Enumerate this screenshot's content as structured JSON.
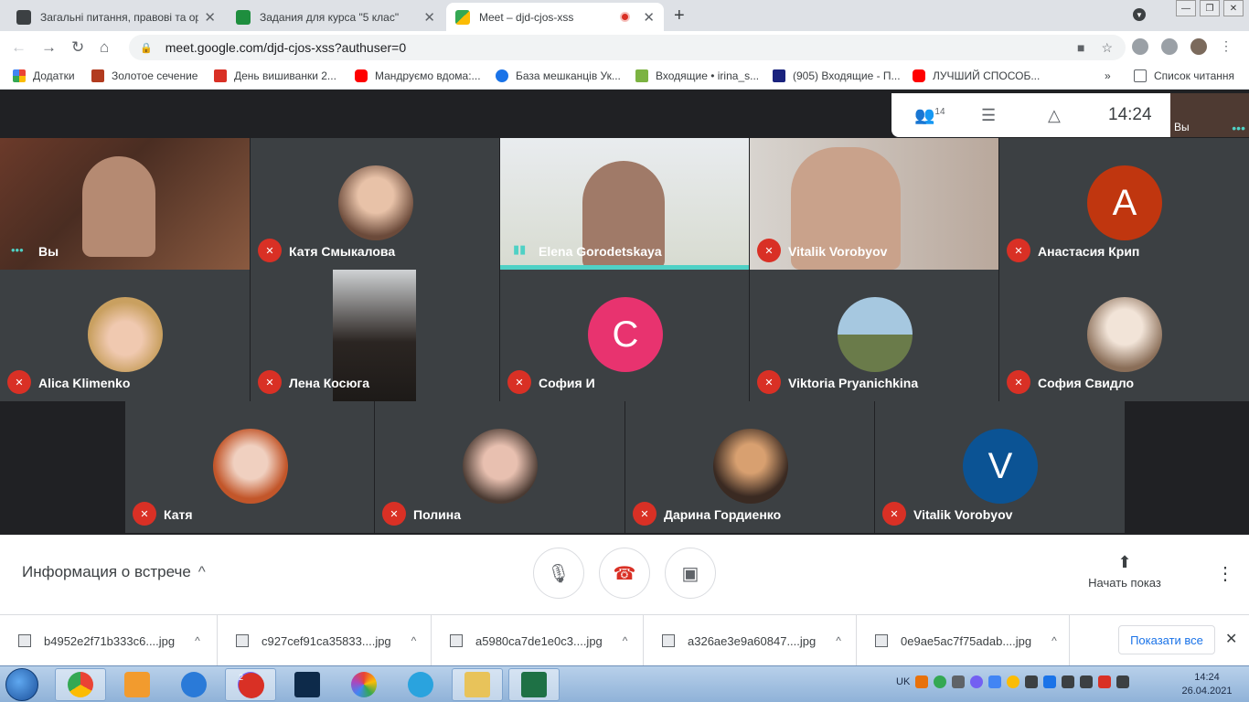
{
  "browser": {
    "tabs": [
      {
        "title": "Загальні питання, правові та ор",
        "active": false
      },
      {
        "title": "Задания для курса \"5 клас\"",
        "active": false
      },
      {
        "title": "Meet – djd-cjos-xss",
        "active": true
      }
    ],
    "url": "meet.google.com/djd-cjos-xss?authuser=0",
    "bookmarks": [
      "Додатки",
      "Золотое сечение",
      "День вишиванки 2...",
      "Мандруємо вдома:...",
      "База мешканців Ук...",
      "Входящие • irina_s...",
      "(905) Входящие - П...",
      "ЛУЧШИЙ СПОСОБ...",
      "Список читання"
    ]
  },
  "meet": {
    "participants_count": "14",
    "clock": "14:24",
    "self_label": "Вы",
    "tiles": [
      {
        "name": "Вы",
        "muted": false,
        "type": "video"
      },
      {
        "name": "Катя Смыкалова",
        "muted": true,
        "type": "photo"
      },
      {
        "name": "Elena Gorodetskaya",
        "muted": false,
        "type": "video",
        "speaking": true
      },
      {
        "name": "Vitalik Vorobyov",
        "muted": true,
        "type": "video"
      },
      {
        "name": "Анастасия Крип",
        "muted": true,
        "type": "letter",
        "letter": "A",
        "color": "#c0360f"
      },
      {
        "name": "Alica Klimenko",
        "muted": true,
        "type": "photo"
      },
      {
        "name": "Лена Косюга",
        "muted": true,
        "type": "video"
      },
      {
        "name": "София И",
        "muted": true,
        "type": "letter",
        "letter": "C",
        "color": "#e8336f"
      },
      {
        "name": "Viktoria Pryanichkina",
        "muted": true,
        "type": "photo"
      },
      {
        "name": "София Свидло",
        "muted": true,
        "type": "photo"
      },
      {
        "name": "Катя",
        "muted": true,
        "type": "photo"
      },
      {
        "name": "Полина",
        "muted": true,
        "type": "photo"
      },
      {
        "name": "Дарина Гордиенко",
        "muted": true,
        "type": "photo"
      },
      {
        "name": "Vitalik Vorobyov",
        "muted": true,
        "type": "letter",
        "letter": "V",
        "color": "#0b5394"
      }
    ],
    "meeting_info_label": "Информация о встрече",
    "present_label": "Начать показ"
  },
  "downloads": {
    "files": [
      "b4952e2f71b333c6....jpg",
      "c927cef91ca35833....jpg",
      "a5980ca7de1e0c3....jpg",
      "a326ae3e9a60847....jpg",
      "0e9ae5ac7f75adab....jpg"
    ],
    "show_all": "Показати все"
  },
  "taskbar": {
    "lang": "UK",
    "viber_badge": "2",
    "time": "14:24",
    "date": "26.04.2021"
  },
  "colors": {
    "meet_bg": "#202124",
    "tile_bg": "#3c4043",
    "muted_red": "#d93025",
    "speaking_teal": "#4fd1c5"
  }
}
